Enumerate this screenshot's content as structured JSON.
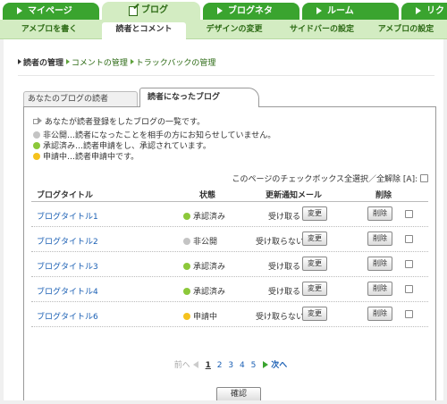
{
  "top_tabs": [
    {
      "label": "マイページ"
    },
    {
      "label": "ブログ"
    },
    {
      "label": "ブログネタ"
    },
    {
      "label": "ルーム"
    },
    {
      "label": "リク"
    }
  ],
  "sub_nav": [
    {
      "label": "アメブロを書く"
    },
    {
      "label": "読者とコメント"
    },
    {
      "label": "デザインの変更"
    },
    {
      "label": "サイドバーの設定"
    },
    {
      "label": "アメブロの設定"
    }
  ],
  "breadcrumb": {
    "current": "読者の管理",
    "link1": "コメントの管理",
    "link2": "トラックバックの管理"
  },
  "panel_tabs": {
    "tab1": "あなたのブログの読者",
    "tab2": "読者になったブログ"
  },
  "intro": "あなたが読者登録をしたブログの一覧です。",
  "legend": {
    "private": "非公開…読者になったことを相手の方にお知らせしていません。",
    "approved": "承認済み…読者申請をし、承認されています。",
    "pending": "申請中…読者申請中です。"
  },
  "select_all": "このページのチェックボックス全選択／全解除 [A]:",
  "table": {
    "headers": {
      "title": "ブログタイトル",
      "status": "状態",
      "notify": "更新通知メール",
      "delete": "削除"
    },
    "rows": [
      {
        "title": "ブログタイトル1",
        "status": "承認済み",
        "status_color": "green",
        "notify": "受け取る",
        "change": "変更",
        "delete": "削除"
      },
      {
        "title": "ブログタイトル2",
        "status": "非公開",
        "status_color": "gray",
        "notify": "受け取らない",
        "change": "変更",
        "delete": "削除"
      },
      {
        "title": "ブログタイトル3",
        "status": "承認済み",
        "status_color": "green",
        "notify": "受け取る",
        "change": "変更",
        "delete": "削除"
      },
      {
        "title": "ブログタイトル4",
        "status": "承認済み",
        "status_color": "green",
        "notify": "受け取る",
        "change": "変更",
        "delete": "削除"
      },
      {
        "title": "ブログタイトル6",
        "status": "申請中",
        "status_color": "yellow",
        "notify": "受け取らない",
        "change": "変更",
        "delete": "削除"
      }
    ]
  },
  "pager": {
    "prev": "前へ",
    "pages": [
      "1",
      "2",
      "3",
      "4",
      "5"
    ],
    "current": "1",
    "next": "次へ"
  },
  "confirm": "確認",
  "colors": {
    "brand_green": "#3aa42f",
    "subnav_bg": "#d3ecc2",
    "link_blue": "#1a5fb4",
    "approved": "#8cc83a",
    "private": "#c4c4c4",
    "pending": "#f5c21d"
  }
}
